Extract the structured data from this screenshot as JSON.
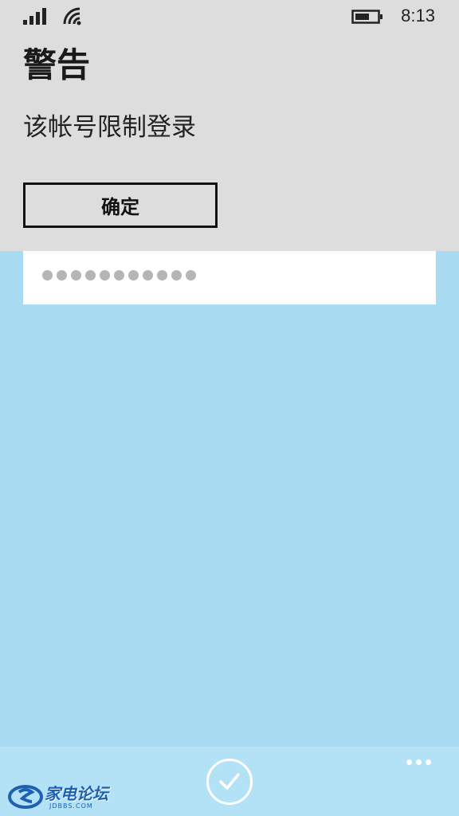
{
  "status_bar": {
    "time": "8:13",
    "signal_icon": "cellular-signal-icon",
    "wifi_icon": "wifi-icon",
    "battery_icon": "battery-icon"
  },
  "alert": {
    "title": "警告",
    "message": "该帐号限制登录",
    "confirm_label": "确定"
  },
  "password_field": {
    "masked_length": 11
  },
  "app_bar": {
    "confirm_icon": "checkmark-icon",
    "more_icon": "more-ellipsis-icon"
  },
  "watermark": {
    "text": "家电论坛",
    "subtext": "JDBBS.COM"
  },
  "colors": {
    "background": "#a9dbf3",
    "alert_background": "#dddddd",
    "app_bar": "#b3e2f7",
    "text": "#1a1a1a"
  }
}
